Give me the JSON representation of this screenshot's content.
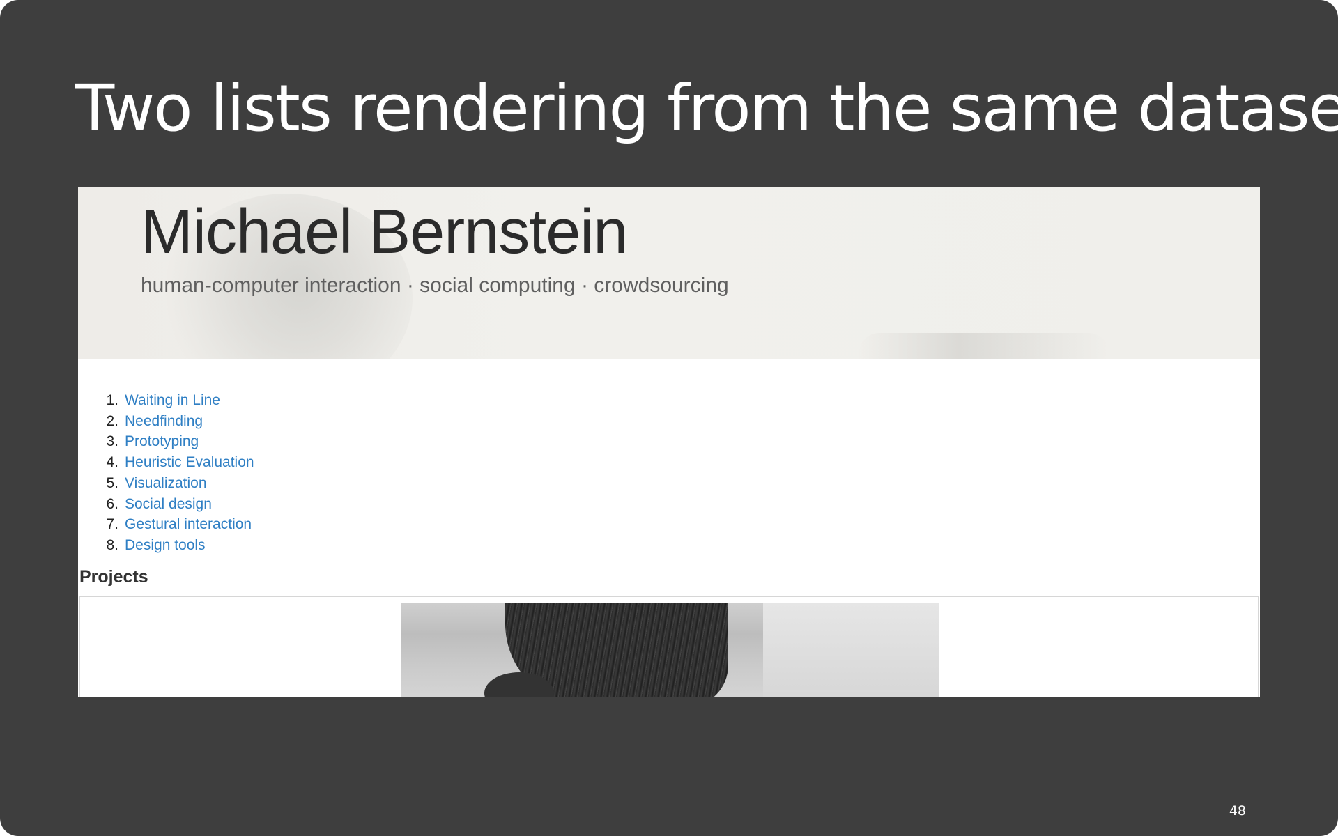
{
  "slide": {
    "title": "Two lists rendering from the same dataset",
    "page_number": "48"
  },
  "website": {
    "name": "Michael Bernstein",
    "tagline": "human-computer interaction · social computing · crowdsourcing",
    "nav_items": [
      {
        "number": "1.",
        "label": "Waiting in Line"
      },
      {
        "number": "2.",
        "label": "Needfinding"
      },
      {
        "number": "3.",
        "label": "Prototyping"
      },
      {
        "number": "4.",
        "label": "Heuristic Evaluation"
      },
      {
        "number": "5.",
        "label": "Visualization"
      },
      {
        "number": "6.",
        "label": "Social design"
      },
      {
        "number": "7.",
        "label": "Gestural interaction"
      },
      {
        "number": "8.",
        "label": "Design tools"
      }
    ],
    "projects_heading": "Projects"
  },
  "colors": {
    "slide_background": "#3e3e3e",
    "link": "#2f7fc4",
    "heading": "#2b2b2b"
  }
}
